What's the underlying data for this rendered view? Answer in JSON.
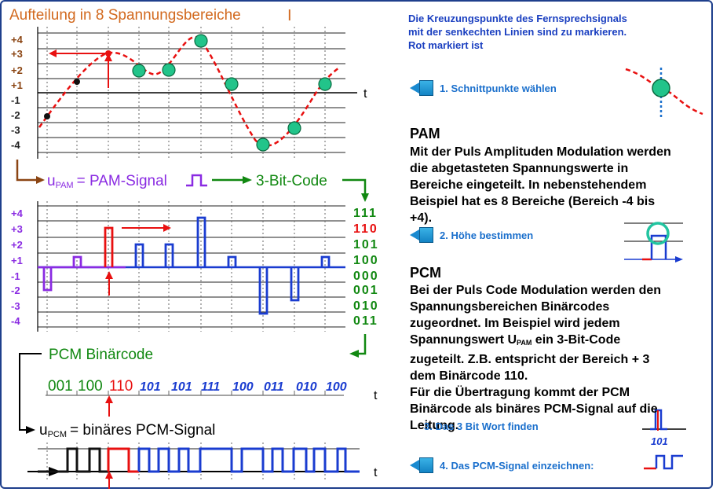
{
  "title": "Aufteilung in 8 Spannungsbereiche",
  "title_cursor": "I",
  "level_labels": [
    "+4",
    "+3",
    "+2",
    "+1",
    "-1",
    "-2",
    "-3",
    "-4"
  ],
  "axis_t": "t",
  "pam": {
    "u_main": "u",
    "u_sub": "PAM",
    "eq": "= PAM-Signal",
    "code_label": "3-Bit-Code"
  },
  "codes": [
    "111",
    "110",
    "101",
    "100",
    "000",
    "001",
    "010",
    "011"
  ],
  "pcm": {
    "label": "PCM Binärcode",
    "words": [
      "001",
      "100",
      "110",
      "101",
      "101",
      "111",
      "100",
      "011",
      "010",
      "100"
    ],
    "u_main": "u",
    "u_sub": "PCM",
    "eq": "= binäres PCM-Signal"
  },
  "note": [
    "Die Kreuzungspunkte des Fernsprechsignals",
    "mit der senkechten Linien sind zu markieren.",
    "Rot markiert ist"
  ],
  "steps": [
    "1. Schnittpunkte wählen",
    "2. Höhe bestimmen",
    "3. Das 3 Bit Wort finden",
    "4. Das PCM-Signal einzeichnen:"
  ],
  "step3_mini": "101",
  "pam_section": {
    "heading": "PAM",
    "lines": [
      "Mit der Puls Amplituden Modulation werden",
      "die abgetasteten Spannungswerte in",
      "Bereiche eingeteilt. In nebenstehendem",
      "Beispiel hat es 8 Bereiche (Bereich -4 bis",
      "+4)."
    ]
  },
  "pcm_section": {
    "heading": "PCM",
    "lines": [
      "Bei der Puls Code Modulation werden den",
      "Spannungsbereichen Binärcodes",
      "zugeordnet. Im Beispiel wird jedem"
    ],
    "line_u_pre": "Spannungswert U",
    "line_u_sub": "PAM",
    "line_u_post": " ein 3-Bit-Code",
    "lines2": [
      "zugeteilt. Z.B. entspricht der Bereich + 3",
      "dem Binärcode 110.",
      "Für die Übertragung kommt der PCM",
      "Binärcode als binäres PCM-Signal auf die",
      "Leitung."
    ]
  },
  "colors": {
    "orange": "#d2691e",
    "red": "#e81010",
    "green": "#118811",
    "blue": "#1a3cd0",
    "purple": "#8a2be2",
    "dot": "#22c48a",
    "text_blue": "#1a3fc0"
  }
}
